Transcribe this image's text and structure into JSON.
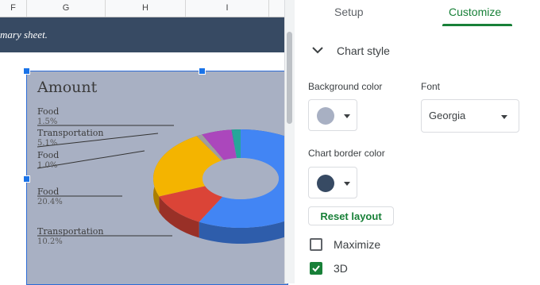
{
  "sheet": {
    "columns": [
      "F",
      "G",
      "H",
      "I"
    ],
    "banner_text": "mary sheet."
  },
  "chart": {
    "title": "Amount",
    "background_color": "#a8b0c3",
    "labels": [
      {
        "name": "Food",
        "pct": "1.5%"
      },
      {
        "name": "Transportation",
        "pct": "5.1%"
      },
      {
        "name": "Food",
        "pct": "1.0%"
      },
      {
        "name": "Food",
        "pct": "20.4%"
      },
      {
        "name": "Transportation",
        "pct": "10.2%"
      }
    ]
  },
  "chart_data": {
    "type": "pie",
    "title": "Amount",
    "donut": true,
    "three_d": true,
    "slices": [
      {
        "label": "",
        "value": 52.5,
        "color": "#4285f4"
      },
      {
        "label": "Transportation",
        "value": 10.2,
        "color": "#db4437"
      },
      {
        "label": "Food",
        "value": 20.4,
        "color": "#f4b400"
      },
      {
        "label": "Food",
        "value": 1.0,
        "color": "#9e9e9e"
      },
      {
        "label": "Transportation",
        "value": 5.1,
        "color": "#ab47bc"
      },
      {
        "label": "Food",
        "value": 1.5,
        "color": "#26a69a"
      }
    ]
  },
  "panel": {
    "tabs": {
      "setup": "Setup",
      "customize": "Customize"
    },
    "section_title": "Chart style",
    "background_color_label": "Background color",
    "background_color": "#a8b0c3",
    "font_label": "Font",
    "font_value": "Georgia",
    "border_color_label": "Chart border color",
    "border_color": "#374a63",
    "reset_label": "Reset layout",
    "maximize_label": "Maximize",
    "threed_label": "3D",
    "maximize_checked": false,
    "threed_checked": true
  }
}
